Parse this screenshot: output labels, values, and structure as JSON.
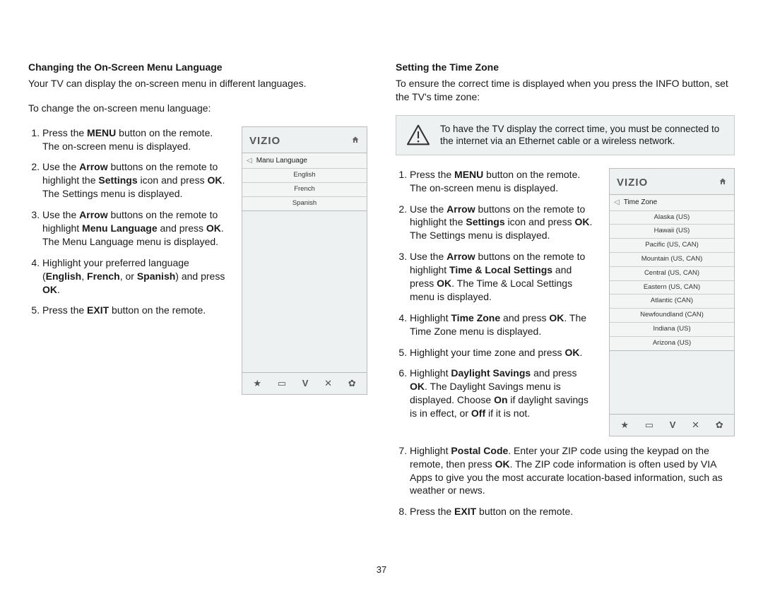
{
  "pageNumber": "37",
  "left": {
    "heading": "Changing the On-Screen Menu Language",
    "intro": "Your TV can display the on-screen menu in different languages.",
    "lead": "To change the on-screen menu language:",
    "steps": [
      "Press the <b>MENU</b> button on the remote. The on-screen menu is displayed.",
      "Use the <b>Arrow</b> buttons on the remote to highlight the <b>Settings</b> icon and press <b>OK</b>. The Settings menu is displayed.",
      "Use the <b>Arrow</b> buttons on the remote to highlight <b>Menu Language</b> and press <b>OK</b>. The Menu Language menu is displayed.",
      "Highlight your preferred language (<b>English</b>, <b>French</b>, or <b>Spanish</b>) and press <b>OK</b>.",
      "Press the <b>EXIT</b> button on the remote."
    ],
    "shot": {
      "brand": "VIZIO",
      "menuTitle": "Manu Language",
      "rows": [
        "English",
        "French",
        "Spanish"
      ]
    }
  },
  "right": {
    "heading": "Setting the Time Zone",
    "intro": "To ensure the correct time is displayed when you press the INFO button, set the TV's time zone:",
    "warning": "To have the TV display the correct time, you must be connected to the internet via an Ethernet cable or a wireless network.",
    "steps": [
      "Press the <b>MENU</b> button on the remote. The on-screen menu is displayed.",
      "Use the <b>Arrow</b> buttons on the remote to highlight the <b>Settings</b> icon and press <b>OK</b>. The Settings menu is displayed.",
      "Use the <b>Arrow</b> buttons on the remote to highlight <b>Time &amp; Local Settings</b> and press <b>OK</b>. The Time &amp; Local Settings menu is displayed.",
      "Highlight <b>Time Zone</b> and press <b>OK</b>. The Time Zone menu is displayed.",
      "Highlight your time zone and press <b>OK</b>.",
      "Highlight <b>Daylight Savings</b> and press <b>OK</b>. The Daylight Savings menu is displayed. Choose <b>On</b> if daylight savings is in effect, or <b>Off</b> if it is not."
    ],
    "postSteps": [
      "Highlight <b>Postal Code</b>. Enter your ZIP code using the keypad on the remote, then press <b>OK</b>. The ZIP code information is often used by VIA Apps to give you the most accurate location-based information, such as weather or news.",
      "Press the <b>EXIT</b> button on the remote."
    ],
    "shot": {
      "brand": "VIZIO",
      "menuTitle": "Time Zone",
      "rows": [
        "Alaska (US)",
        "Hawaii (US)",
        "Pacific (US, CAN)",
        "Mountain (US, CAN)",
        "Central (US, CAN)",
        "Eastern (US, CAN)",
        "Atlantic (CAN)",
        "Newfoundland (CAN)",
        "Indiana (US)",
        "Arizona (US)"
      ]
    }
  }
}
